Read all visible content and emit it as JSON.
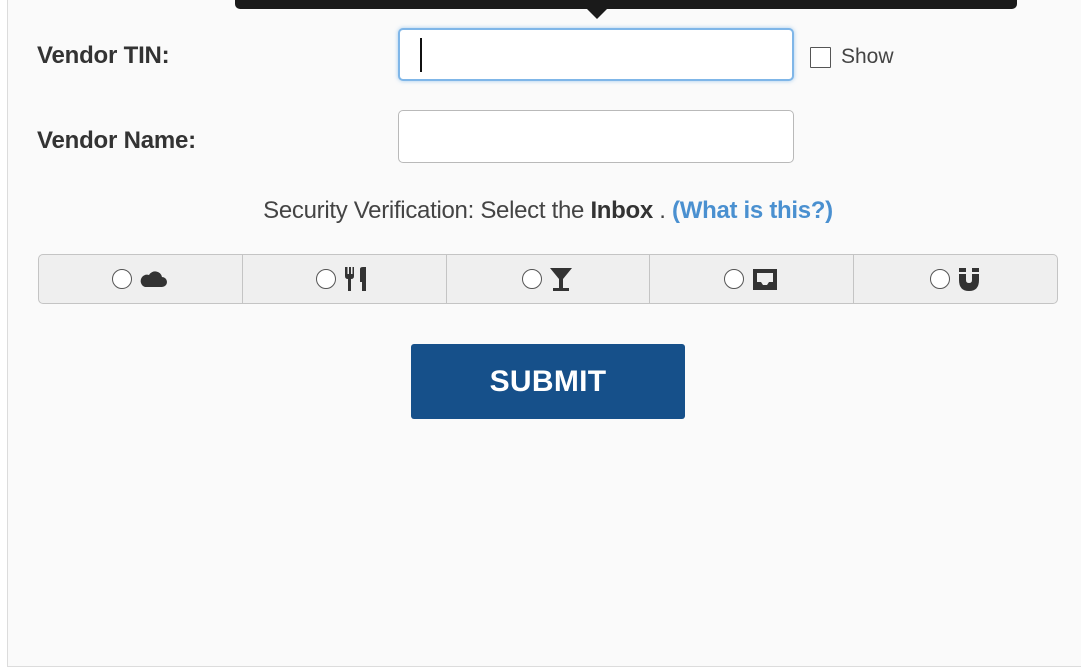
{
  "form": {
    "vendor_tin": {
      "label": "Vendor TIN:",
      "value": "",
      "placeholder": ""
    },
    "show_toggle": {
      "label": "Show",
      "checked": false
    },
    "vendor_name": {
      "label": "Vendor Name:",
      "value": "",
      "placeholder": ""
    }
  },
  "security": {
    "prefix": "Security Verification: Select the ",
    "target": "Inbox",
    "suffix": " . ",
    "help_link": "(What is this?)",
    "options": [
      {
        "icon": "cloud-icon",
        "selected": false
      },
      {
        "icon": "utensils-icon",
        "selected": false
      },
      {
        "icon": "filter-icon",
        "selected": false
      },
      {
        "icon": "inbox-icon",
        "selected": false
      },
      {
        "icon": "magnet-icon",
        "selected": false
      }
    ]
  },
  "submit": {
    "label": "SUBMIT"
  },
  "colors": {
    "submit_bg": "#16508a",
    "link": "#4a90d0",
    "focus_border": "#7fb6e8",
    "panel_bg": "#fafafa"
  }
}
